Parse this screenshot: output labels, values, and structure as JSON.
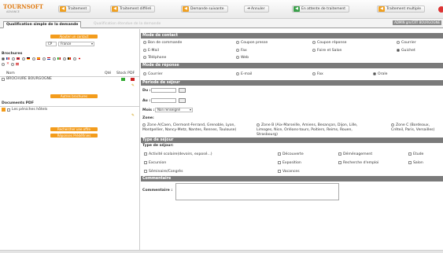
{
  "app": {
    "logo": "TOURNSOFT",
    "logo_sub": "ADVANCE"
  },
  "toolbar": {
    "traitement": "Traitement",
    "traitement_differe": "Traitement différé",
    "demande_suivante": "Demande suivante",
    "annuler": "Annuler",
    "en_attente": "En attente de traitement",
    "traitement_multiple": "Traitement multiple"
  },
  "tabs": {
    "active": "Qualification simple de la demande",
    "inactive": "Qualification étendue de la demande",
    "right_label": "ADMIN gm/CRT BOURGOGNE"
  },
  "left": {
    "ajouter_contact": "Ajouter un contact",
    "country_code": "CP",
    "country": "France",
    "brochures_title": "Brochures",
    "col_nom": "Nom",
    "col_qte": "Qté",
    "col_stock_pdf": "Stock PDF",
    "brochure_item": "BROCHURE BOURGOGNE",
    "autres_brochures": "Autres brochures",
    "documents_pdf_title": "Documents PDF",
    "pdf_item": "Les péniches hôtels",
    "rechercher_offre": "Rechercher une offre",
    "reponses_predefinies": "Réponses Prédéfinies"
  },
  "mode_contact": {
    "title": "Mode de contact",
    "options": [
      "Bon de commande",
      "Coupon presse",
      "Coupon réponse",
      "Courrier",
      "E-Mail",
      "Fax",
      "Foire et Salon",
      "Guichet",
      "Téléphone",
      "Web"
    ],
    "selected": "Guichet"
  },
  "mode_reponse": {
    "title": "Mode de réponse",
    "options": [
      "Courrier",
      "E-mail",
      "Fax",
      "Orale"
    ],
    "selected": "Orale"
  },
  "periode": {
    "title": "Période de séjour",
    "du_label": "Du :",
    "au_label": "Au :",
    "mois_label": "Mois :",
    "mois_value": "Non renseigné",
    "zone_label": "Zone:",
    "zones": [
      "Zone A(Caen, Clermont-Ferrand, Grenoble, Lyon, Montpellier, Nancy-Metz, Nantes, Rennes, Toulouse)",
      "Zone B (Aix-Marseille, Amiens, Besançon, Dijon, Lille, Limoges, Nice, Orléans-tours, Poitiers, Reims, Rouen, Strasbourg)",
      "Zone C (Bordeaux, Créteil, Paris, Versailles)"
    ]
  },
  "type_sejour": {
    "title": "Type de séjour",
    "sub_label": "Type de séjour:",
    "options": [
      "Activité scolaire(devoirs, exposé...)",
      "Découverte",
      "Déménagement",
      "Etude",
      "Excursion",
      "Exposition",
      "Recherche d'emploi",
      "Salon",
      "Séminaire/Congrès",
      "Vacances"
    ]
  },
  "commentaire": {
    "title": "Commentaire",
    "label": "Commentaire :"
  }
}
